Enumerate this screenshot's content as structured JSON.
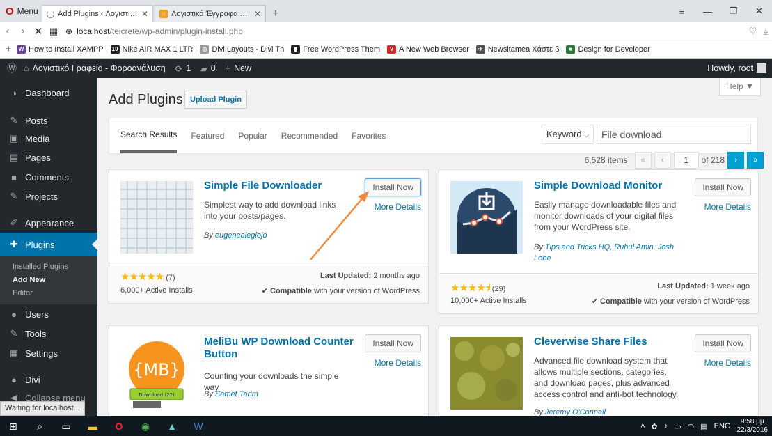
{
  "browser": {
    "menu_label": "Menu",
    "tabs": [
      {
        "title": "Add Plugins ‹ Λογιστικό Γρ",
        "active": true,
        "loading": true
      },
      {
        "title": "Λογιστικά Έγγραφα – Λογ",
        "active": false,
        "loading": false
      }
    ],
    "url_host": "localhost",
    "url_path": "/teicrete/wp-admin/plugin-install.php",
    "bookmarks": [
      {
        "label": "How to Install XAMPP",
        "icon_text": "W",
        "color": "#6b3fa0"
      },
      {
        "label": "Nike AIR MAX 1 LTR",
        "icon_text": "10",
        "color": "#222"
      },
      {
        "label": "Divi Layouts - Divi Th",
        "icon_text": "◎",
        "color": "#999"
      },
      {
        "label": "Free WordPress Them",
        "icon_text": "▮",
        "color": "#222"
      },
      {
        "label": "A New Web Browser",
        "icon_text": "V",
        "color": "#d62a2a"
      },
      {
        "label": "Newsitamea Χάστε β",
        "icon_text": "✈",
        "color": "#555"
      },
      {
        "label": "Design for Developer",
        "icon_text": "■",
        "color": "#2a7a3a"
      }
    ],
    "status_message": "Waiting for localhost..."
  },
  "adminbar": {
    "site_name": "Λογιστικό Γραφείο - Φοροανάλυση",
    "updates_count": "1",
    "comments_count": "0",
    "new_label": "New",
    "howdy": "Howdy, root"
  },
  "sidebar": {
    "items": [
      {
        "label": "Dashboard",
        "icon": "◑"
      },
      {
        "label": "Posts",
        "icon": "✎"
      },
      {
        "label": "Media",
        "icon": "▣"
      },
      {
        "label": "Pages",
        "icon": "▤"
      },
      {
        "label": "Comments",
        "icon": "■"
      },
      {
        "label": "Projects",
        "icon": "✎"
      },
      {
        "label": "Appearance",
        "icon": "✐"
      },
      {
        "label": "Plugins",
        "icon": "✚"
      },
      {
        "label": "Users",
        "icon": "●"
      },
      {
        "label": "Tools",
        "icon": "✎"
      },
      {
        "label": "Settings",
        "icon": "▦"
      },
      {
        "label": "Divi",
        "icon": "●"
      },
      {
        "label": "Collapse menu",
        "icon": "◀"
      }
    ],
    "plugins_sub": [
      "Installed Plugins",
      "Add New",
      "Editor"
    ]
  },
  "page": {
    "title": "Add Plugins",
    "upload_label": "Upload Plugin",
    "help_label": "Help ▼",
    "filter_tabs": [
      "Search Results",
      "Featured",
      "Popular",
      "Recommended",
      "Favorites"
    ],
    "search_type": "Keyword",
    "search_value": "File download",
    "items_count": "6,528 items",
    "page_current": "1",
    "page_total": "of 218"
  },
  "plugins": [
    {
      "name": "Simple File Downloader",
      "install_label": "Install Now",
      "more_label": "More Details",
      "description": "Simplest way to add download links into your posts/pages.",
      "author_prefix": "By ",
      "author": "eugenealegiojo",
      "stars": "★★★★★",
      "rating_count": "(7)",
      "installs": "6,000+ Active Installs",
      "updated_label": "Last Updated:",
      "updated_value": "2 months ago",
      "compat_label": "Compatible",
      "compat_rest": "with your version of WordPress"
    },
    {
      "name": "Simple Download Monitor",
      "install_label": "Install Now",
      "more_label": "More Details",
      "description": "Easily manage downloadable files and monitor downloads of your digital files from your WordPress site.",
      "author_prefix": "By ",
      "author": "Tips and Tricks HQ, Ruhul Amin, Josh Lobe",
      "stars": "★★★★⯨",
      "rating_count": "(29)",
      "installs": "10,000+ Active Installs",
      "updated_label": "Last Updated:",
      "updated_value": "1 week ago",
      "compat_label": "Compatible",
      "compat_rest": "with your version of WordPress"
    },
    {
      "name": "MeliBu WP Download Counter Button",
      "install_label": "Install Now",
      "more_label": "More Details",
      "description": "Counting your downloads the simple way",
      "author_prefix": "By ",
      "author": "Samet Tarim",
      "thumb_text": "{MB}",
      "thumb_badge": "Download (22)"
    },
    {
      "name": "Cleverwise Share Files",
      "install_label": "Install Now",
      "more_label": "More Details",
      "description": "Advanced file download system that allows multiple sections, categories, and download pages, plus advanced access control and anti-bot technology.",
      "author_prefix": "By ",
      "author": "Jeremy O'Connell"
    }
  ],
  "taskbar": {
    "lang": "ENG",
    "time": "9:58 μμ",
    "date": "22/3/2016"
  },
  "colors": {
    "wp_blue": "#0073aa",
    "admin_dark": "#23282d",
    "star": "#ffb900",
    "arrow": "#f08a3c"
  }
}
